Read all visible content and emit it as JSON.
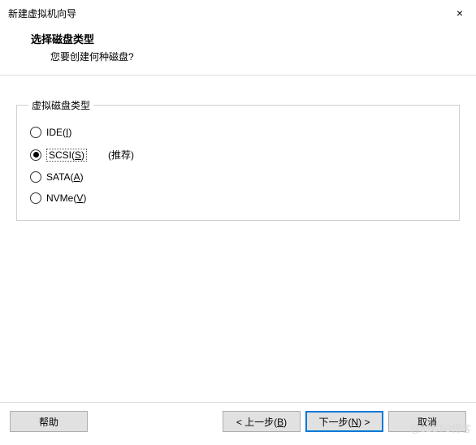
{
  "title": "新建虚拟机向导",
  "close_glyph": "×",
  "header": {
    "heading": "选择磁盘类型",
    "subheading": "您要创建何种磁盘?"
  },
  "group": {
    "legend": "虚拟磁盘类型",
    "recommended": "(推荐)",
    "options": [
      {
        "label_prefix": "IDE(",
        "hotkey": "I",
        "label_suffix": ")",
        "checked": false
      },
      {
        "label_prefix": "SCSI(",
        "hotkey": "S",
        "label_suffix": ")",
        "checked": true
      },
      {
        "label_prefix": "SATA(",
        "hotkey": "A",
        "label_suffix": ")",
        "checked": false
      },
      {
        "label_prefix": "NVMe(",
        "hotkey": "V",
        "label_suffix": ")",
        "checked": false
      }
    ]
  },
  "footer": {
    "help": "帮助",
    "back_prefix": "< 上一步(",
    "back_hotkey": "B",
    "back_suffix": ")",
    "next_prefix": "下一步(",
    "next_hotkey": "N",
    "next_suffix": ") >",
    "cancel": "取消"
  },
  "watermark": "@51CTO博客"
}
